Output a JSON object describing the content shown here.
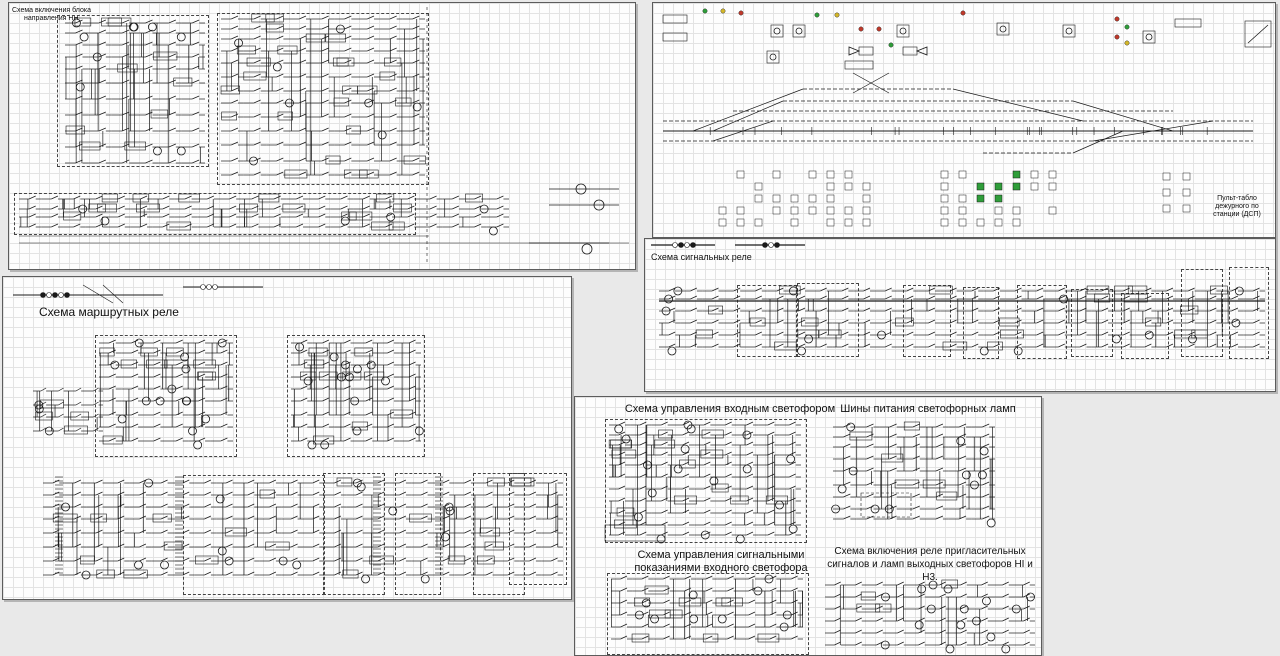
{
  "sheets": {
    "block_nn": {
      "title_line1": "Схема включения блока",
      "title_line2": "направления НН"
    },
    "console": {
      "caption_line1": "Пульт-табло дежурного по",
      "caption_line2": "станции (ДСП)"
    },
    "signal_relays": {
      "title": "Схема сигнальных реле"
    },
    "route_relays": {
      "title": "Схема маршрутных реле"
    },
    "entry_signal": {
      "title_control": "Схема управления входным светофором",
      "title_power": "Шины питания светофорных ламп",
      "title_indications_line1": "Схема управления сигнальными",
      "title_indications_line2": "показаниями входного светофора",
      "title_invite_line1": "Схема включения реле пригласительных",
      "title_invite_line2": "сигналов и ламп выходных светофоров НI и Н3."
    }
  },
  "colors": {
    "line": "#1a1a1a",
    "grid": "#e3e3e3",
    "lamp_green": "#2f9e3a",
    "lamp_red": "#c0392b",
    "lamp_yellow": "#d4b72a",
    "background": "#e9e9e9"
  }
}
